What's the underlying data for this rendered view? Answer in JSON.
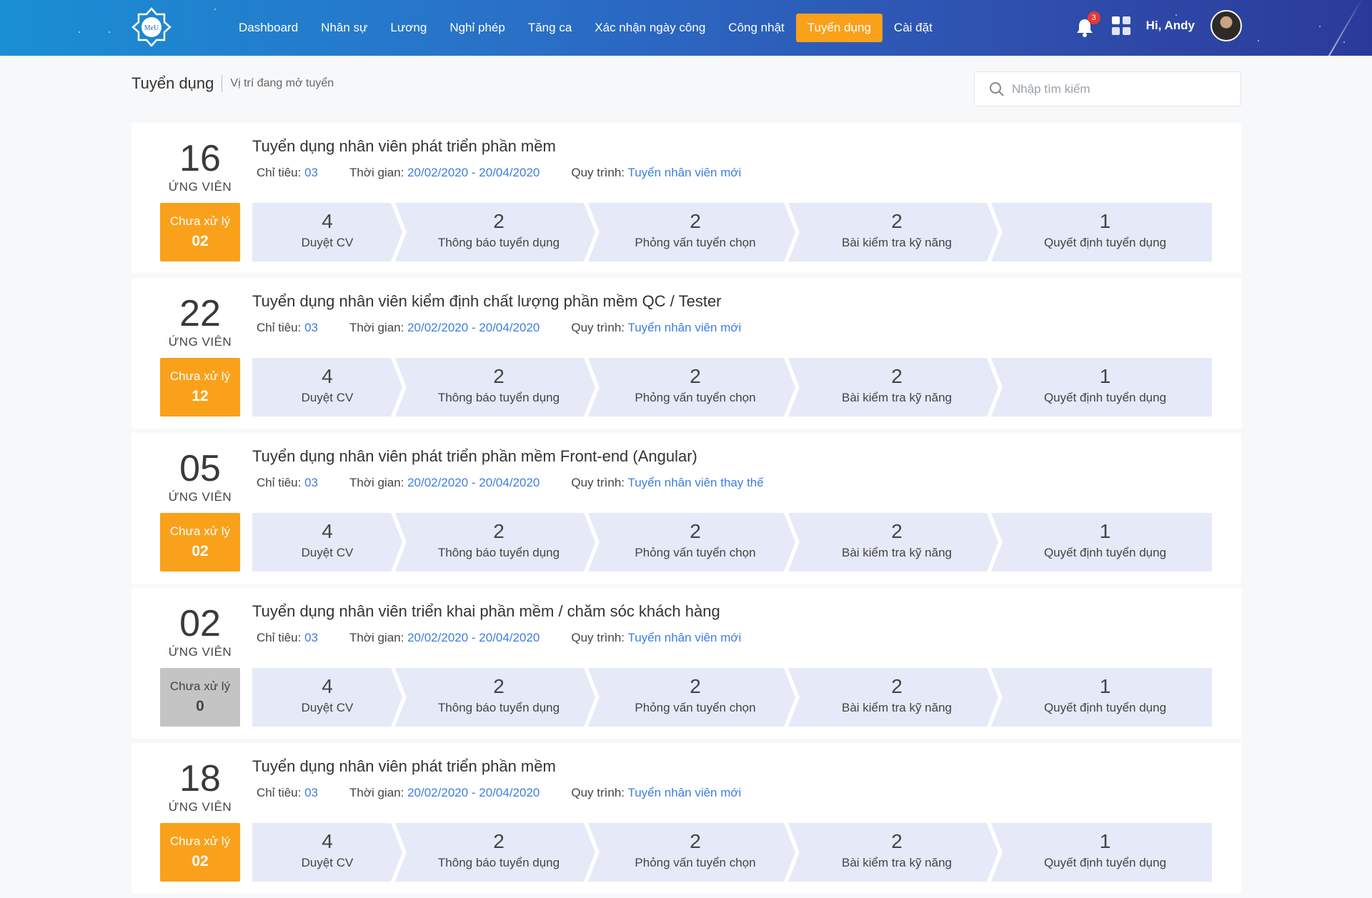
{
  "header": {
    "logo_text": "MeU",
    "nav": [
      {
        "label": "Dashboard",
        "active": false
      },
      {
        "label": "Nhân sự",
        "active": false
      },
      {
        "label": "Lương",
        "active": false
      },
      {
        "label": "Nghỉ phép",
        "active": false
      },
      {
        "label": "Tăng ca",
        "active": false
      },
      {
        "label": "Xác nhận ngày công",
        "active": false
      },
      {
        "label": "Công nhật",
        "active": false
      },
      {
        "label": "Tuyển dụng",
        "active": true
      },
      {
        "label": "Cài đặt",
        "active": false
      }
    ],
    "notification_count": "3",
    "greeting": "Hi, Andy",
    "accent_color": "#f9a11b"
  },
  "page": {
    "title": "Tuyển dụng",
    "subtitle": "Vị trí đang mở tuyển",
    "search_placeholder": "Nhập tìm kiếm"
  },
  "labels": {
    "candidates": "ỨNG VIÊN",
    "pending": "Chưa xử lý",
    "quota": "Chỉ tiêu: ",
    "time": "Thời gian: ",
    "process": "Quy trình: "
  },
  "jobs": [
    {
      "count": "16",
      "title": "Tuyển dụng nhân viên phát triển phần mềm",
      "quota": "03",
      "period": "20/02/2020 - 20/04/2020",
      "process": "Tuyển nhân viên mới",
      "pending": "02",
      "pending_status": "orange",
      "steps": [
        {
          "value": "4",
          "label": "Duyệt CV"
        },
        {
          "value": "2",
          "label": "Thông báo tuyển dụng"
        },
        {
          "value": "2",
          "label": "Phỏng vấn tuyển chọn"
        },
        {
          "value": "2",
          "label": "Bài kiểm tra kỹ năng"
        },
        {
          "value": "1",
          "label": "Quyết định tuyển dụng"
        }
      ]
    },
    {
      "count": "22",
      "title": "Tuyển dụng nhân viên kiểm định chất lượng phần mềm QC / Tester",
      "quota": "03",
      "period": "20/02/2020 - 20/04/2020",
      "process": "Tuyển nhân viên mới",
      "pending": "12",
      "pending_status": "orange",
      "steps": [
        {
          "value": "4",
          "label": "Duyệt CV"
        },
        {
          "value": "2",
          "label": "Thông báo tuyển dụng"
        },
        {
          "value": "2",
          "label": "Phỏng vấn tuyển chọn"
        },
        {
          "value": "2",
          "label": "Bài kiểm tra kỹ năng"
        },
        {
          "value": "1",
          "label": "Quyết định tuyển dụng"
        }
      ]
    },
    {
      "count": "05",
      "title": "Tuyển dụng nhân viên phát triển phần mềm Front-end (Angular)",
      "quota": "03",
      "period": "20/02/2020 - 20/04/2020",
      "process": "Tuyển nhân viên thay thế",
      "pending": "02",
      "pending_status": "orange",
      "steps": [
        {
          "value": "4",
          "label": "Duyệt CV"
        },
        {
          "value": "2",
          "label": "Thông báo tuyển dụng"
        },
        {
          "value": "2",
          "label": "Phỏng vấn tuyển chọn"
        },
        {
          "value": "2",
          "label": "Bài kiểm tra kỹ năng"
        },
        {
          "value": "1",
          "label": "Quyết định tuyển dụng"
        }
      ]
    },
    {
      "count": "02",
      "title": "Tuyển dụng nhân viên triển khai phần mềm / chăm sóc khách hàng",
      "quota": "03",
      "period": "20/02/2020 - 20/04/2020",
      "process": "Tuyển nhân viên mới",
      "pending": "0",
      "pending_status": "grey",
      "steps": [
        {
          "value": "4",
          "label": "Duyệt CV"
        },
        {
          "value": "2",
          "label": "Thông báo tuyển dụng"
        },
        {
          "value": "2",
          "label": "Phỏng vấn tuyển chọn"
        },
        {
          "value": "2",
          "label": "Bài kiểm tra kỹ năng"
        },
        {
          "value": "1",
          "label": "Quyết định tuyển dụng"
        }
      ]
    },
    {
      "count": "18",
      "title": "Tuyển dụng nhân viên phát triển phần mềm",
      "quota": "03",
      "period": "20/02/2020 - 20/04/2020",
      "process": "Tuyển nhân viên mới",
      "pending": "02",
      "pending_status": "orange",
      "steps": [
        {
          "value": "4",
          "label": "Duyệt CV"
        },
        {
          "value": "2",
          "label": "Thông báo tuyển dụng"
        },
        {
          "value": "2",
          "label": "Phỏng vấn tuyển chọn"
        },
        {
          "value": "2",
          "label": "Bài kiểm tra kỹ năng"
        },
        {
          "value": "1",
          "label": "Quyết định tuyển dụng"
        }
      ]
    }
  ]
}
